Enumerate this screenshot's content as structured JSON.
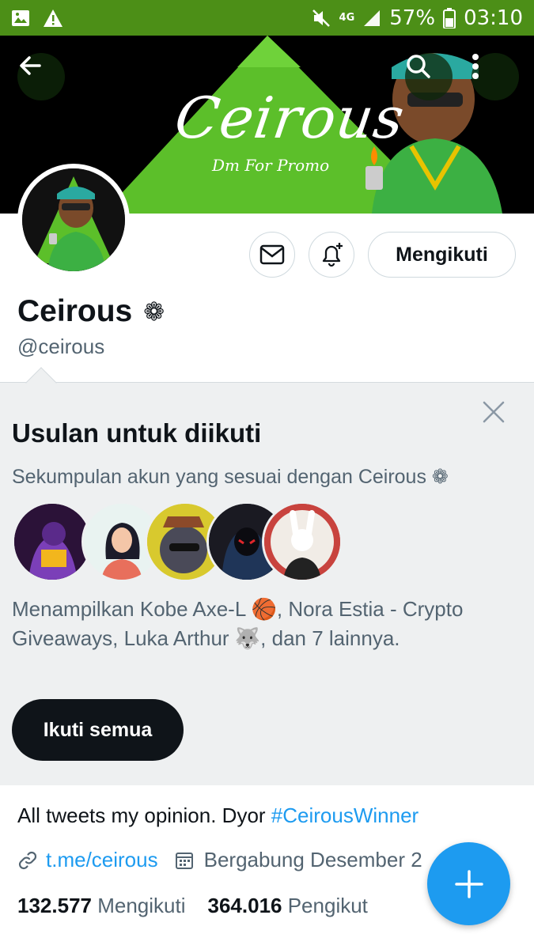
{
  "status_bar": {
    "network": "4G",
    "battery": "57%",
    "time": "03:10"
  },
  "banner": {
    "title": "Ceirous",
    "subtitle": "Dm For Promo"
  },
  "header": {
    "back_icon": "arrow-left-icon",
    "search_icon": "search-icon",
    "more_icon": "more-vertical-icon"
  },
  "profile": {
    "follow_button": "Mengikuti",
    "name": "Ceirous",
    "name_emoji": "❁",
    "handle": "@ceirous",
    "bio_text": "All tweets my opinion. Dyor ",
    "bio_hashtag": "#CeirousWinner",
    "link": "t.me/ceirous",
    "joined": "Bergabung Desember 2",
    "following_count": "132.577",
    "following_label": "Mengikuti",
    "followers_count": "364.016",
    "followers_label": "Pengikut"
  },
  "suggestions": {
    "title": "Usulan untuk diikuti",
    "subtitle": "Sekumpulan akun yang sesuai dengan Ceirous ❁",
    "description": "Menampilkan Kobe Axe-L 🏀, Nora Estia - Crypto Giveaways, Luka Arthur 🐺, dan 7 lainnya.",
    "follow_all": "Ikuti semua"
  },
  "colors": {
    "status_bar": "#4c8f17",
    "accent": "#1d9bf0",
    "banner_green": "#5cbf2a"
  }
}
